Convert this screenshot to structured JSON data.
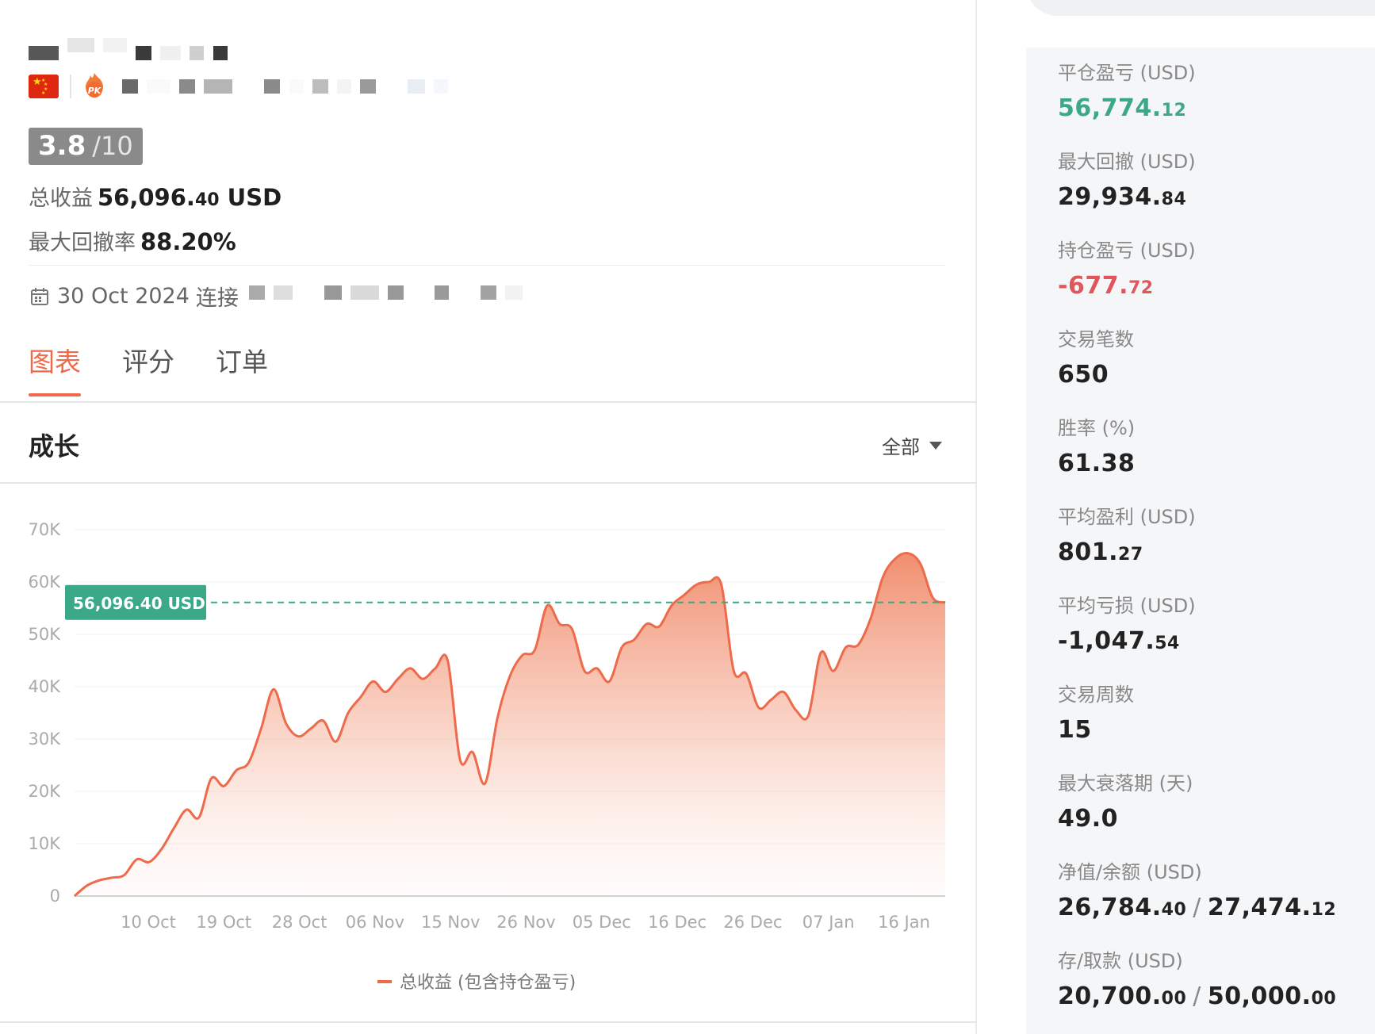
{
  "colors": {
    "accent": "#ee6a4a",
    "green": "#3ba987",
    "red": "#e0565a",
    "score_bg": "#8a8a8a"
  },
  "profile": {
    "score": "3.8",
    "score_max": "/10",
    "total_return_label": "总收益",
    "total_return_int": "56,096.",
    "total_return_dec": "40",
    "total_return_unit": "USD",
    "max_drawdown_rate_label": "最大回撤率",
    "max_drawdown_rate": "88.20%",
    "connected_date": "30 Oct 2024",
    "connected_label": "连接"
  },
  "tabs": [
    {
      "label": "图表",
      "active": true
    },
    {
      "label": "评分",
      "active": false
    },
    {
      "label": "订单",
      "active": false
    }
  ],
  "section": {
    "title": "成长",
    "range_label": "全部"
  },
  "chart_data": {
    "type": "area",
    "y_ticks": [
      "70K",
      "60K",
      "50K",
      "40K",
      "30K",
      "20K",
      "10K",
      "0"
    ],
    "ylim": [
      0,
      70000
    ],
    "x_ticks": [
      "10 Oct",
      "19 Oct",
      "28 Oct",
      "06 Nov",
      "15 Nov",
      "26 Nov",
      "05 Dec",
      "16 Dec",
      "26 Dec",
      "07 Jan",
      "16 Jan"
    ],
    "current_value_label": "56,096.40 USD",
    "current_value": 56096.4,
    "legend": "总收益 (包含持仓盈亏)",
    "series": [
      {
        "name": "总收益 (包含持仓盈亏)",
        "values": [
          0,
          2000,
          3000,
          3500,
          4000,
          7000,
          6500,
          9000,
          13000,
          16500,
          15000,
          22500,
          21000,
          24000,
          25500,
          32000,
          39500,
          33000,
          30500,
          32000,
          33500,
          29500,
          35000,
          38000,
          41000,
          39000,
          41500,
          43500,
          41500,
          43500,
          45000,
          26000,
          27500,
          21500,
          34000,
          42000,
          46000,
          47000,
          55500,
          52000,
          51000,
          43000,
          43500,
          41000,
          47500,
          49000,
          52000,
          51500,
          55500,
          57500,
          59500,
          60000,
          59500,
          43000,
          42500,
          36000,
          37500,
          39000,
          35500,
          34500,
          46500,
          43000,
          47500,
          48000,
          53000,
          61000,
          64500,
          65500,
          63500,
          57000,
          56096
        ]
      }
    ]
  },
  "stats": [
    {
      "label": "平仓盈亏 (USD)",
      "int": "56,774.",
      "dec": "12",
      "tone": "green"
    },
    {
      "label": "最大回撤 (USD)",
      "int": "29,934.",
      "dec": "84",
      "tone": ""
    },
    {
      "label": "持仓盈亏 (USD)",
      "int": "-677.",
      "dec": "72",
      "tone": "red"
    },
    {
      "label": "交易笔数",
      "int": "650",
      "dec": "",
      "tone": ""
    },
    {
      "label": "胜率 (%)",
      "int": "61.38",
      "dec": "",
      "tone": ""
    },
    {
      "label": "平均盈利 (USD)",
      "int": "801.",
      "dec": "27",
      "tone": ""
    },
    {
      "label": "平均亏损 (USD)",
      "int": "-1,047.",
      "dec": "54",
      "tone": ""
    },
    {
      "label": "交易周数",
      "int": "15",
      "dec": "",
      "tone": ""
    },
    {
      "label": "最大衰落期 (天)",
      "int": "49.0",
      "dec": "",
      "tone": ""
    },
    {
      "label": "净值/余额 (USD)",
      "int": "26,784.",
      "dec": "40",
      "int2": "27,474.",
      "dec2": "12",
      "tone": ""
    },
    {
      "label": "存/取款 (USD)",
      "int": "20,700.",
      "dec": "00",
      "int2": "50,000.",
      "dec2": "00",
      "tone": ""
    }
  ]
}
